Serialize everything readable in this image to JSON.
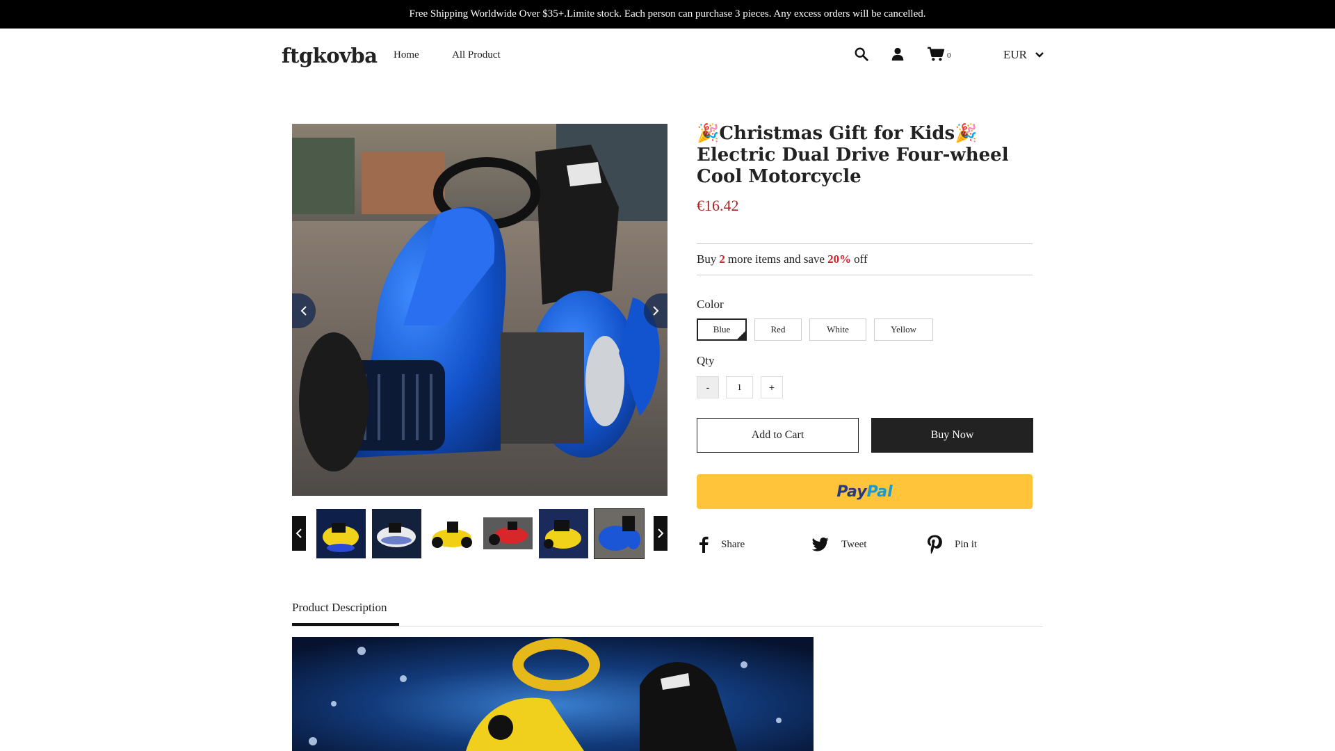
{
  "announcement": "Free Shipping Worldwide Over $35+.Limite stock. Each person can purchase 3 pieces. Any excess orders will be cancelled.",
  "header": {
    "logo": "ftgkovba",
    "nav": [
      "Home",
      "All Product"
    ],
    "cart_count": "0",
    "currency": "EUR",
    "icons": [
      "search-icon",
      "user-icon",
      "cart-icon",
      "chevron-down-icon"
    ]
  },
  "gallery": {
    "thumbnail_colors": [
      "yellow",
      "white",
      "yellow",
      "red",
      "yellow",
      "blue"
    ],
    "active_thumbnail": 5
  },
  "product": {
    "title": "🎉Christmas Gift for Kids🎉Electric Dual Drive Four-wheel Cool Motorcycle",
    "price": "€16.42",
    "promo": {
      "prefix": "Buy",
      "qty": "2",
      "middle": "more items and save",
      "percent": "20%",
      "suffix": "off"
    },
    "color_label": "Color",
    "colors": [
      "Blue",
      "Red",
      "White",
      "Yellow"
    ],
    "selected_color": "Blue",
    "qty_label": "Qty",
    "qty_minus": "-",
    "qty_value": "1",
    "qty_plus": "+",
    "add_to_cart": "Add to Cart",
    "buy_now": "Buy Now",
    "paypal_1": "Pay",
    "paypal_2": "Pal"
  },
  "share": {
    "facebook": "Share",
    "twitter": "Tweet",
    "pinterest": "Pin it"
  },
  "description": {
    "tab": "Product Description"
  },
  "colors": {
    "accent_price": "#a52626",
    "promo_highlight": "#d6232a",
    "paypal": "#ffc439",
    "announcement_bg": "#000000"
  }
}
